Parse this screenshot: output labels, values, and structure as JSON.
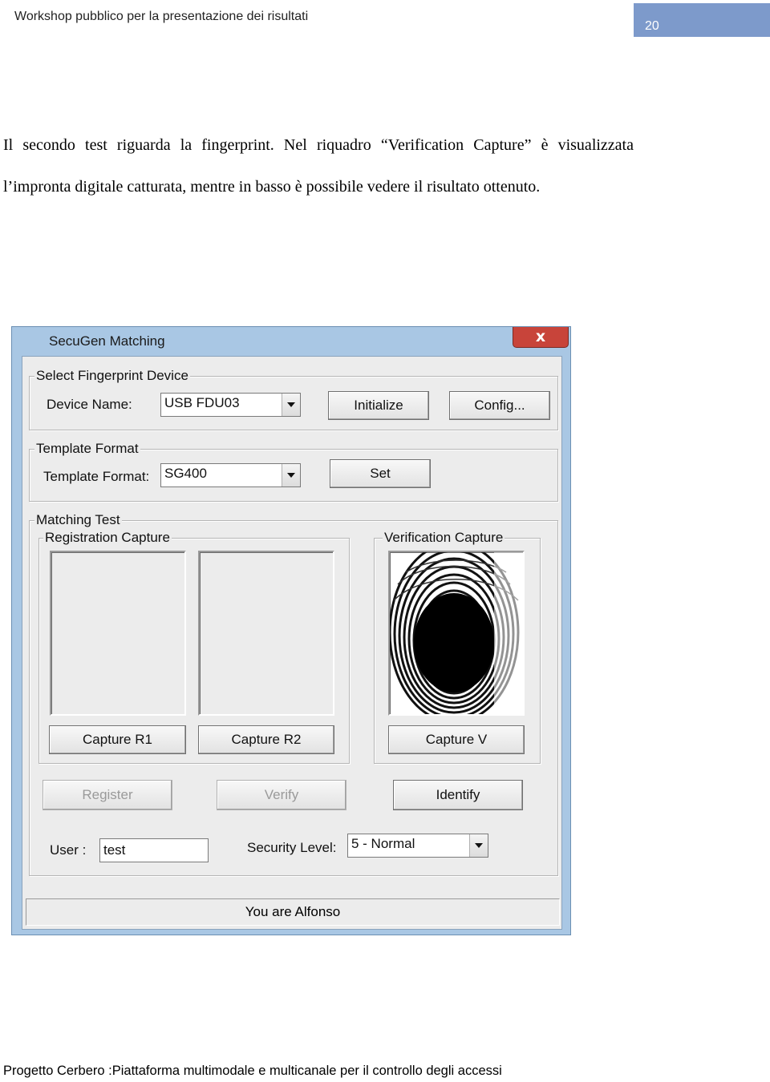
{
  "header": {
    "title": "Workshop pubblico per la presentazione dei risultati",
    "page_number": "20"
  },
  "body_text": "Il secondo test riguarda la fingerprint. Nel riquadro “Verification Capture” è visualizzata l’impronta digitale catturata, mentre in basso è possibile vedere il risultato ottenuto.",
  "window": {
    "title": "SecuGen Matching",
    "close_glyph": "x",
    "device_group": {
      "label": "Select Fingerprint Device",
      "device_name_label": "Device Name:",
      "device_name_value": "USB FDU03",
      "initialize_label": "Initialize",
      "config_label": "Config..."
    },
    "template_group": {
      "label": "Template Format",
      "template_format_label": "Template Format:",
      "template_format_value": "SG400",
      "set_label": "Set"
    },
    "matching_group": {
      "label": "Matching Test",
      "registration_label": "Registration Capture",
      "verification_label": "Verification Capture",
      "capture_r1_label": "Capture R1",
      "capture_r2_label": "Capture R2",
      "capture_v_label": "Capture V",
      "register_label": "Register",
      "verify_label": "Verify",
      "identify_label": "Identify",
      "user_label": "User :",
      "user_value": "test",
      "security_level_label": "Security Level:",
      "security_level_value": "5 - Normal"
    },
    "status_text": "You are Alfonso"
  },
  "footer": {
    "text": "Progetto Cerbero :Piattaforma multimodale e multicanale per il controllo degli accessi"
  }
}
